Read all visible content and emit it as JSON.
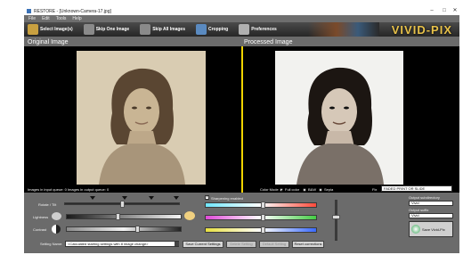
{
  "window": {
    "title": "RESTORE - [Unknown-Camera-17.jpg]",
    "minimize_glyph": "–",
    "maximize_glyph": "□",
    "close_glyph": "✕"
  },
  "menu": [
    "File",
    "Edit",
    "Tools",
    "Help"
  ],
  "toolbar": {
    "items": [
      {
        "label": "Select Image(s)",
        "icon": "folder-icon",
        "color": "#c8a040"
      },
      {
        "label": "Skip One Image",
        "icon": "skip-icon",
        "color": "#8a8a8a"
      },
      {
        "label": "Skip All Images",
        "icon": "skip-all-icon",
        "color": "#8a8a8a"
      },
      {
        "label": "Cropping",
        "icon": "crop-icon",
        "color": "#5a8ac0"
      },
      {
        "label": "Preferences",
        "icon": "tools-icon",
        "color": "#b0b0b0"
      }
    ],
    "brand": "VIVID-PIX"
  },
  "panels": {
    "original_label": "Original Image",
    "processed_label": "Processed Image"
  },
  "status": {
    "text": "Images in input queue: 0  Images in output queue: 0"
  },
  "controls": {
    "rotate_tilt_label": "Rotate / Tilt",
    "lightness_label": "Lightness",
    "contrast_label": "Contrast",
    "sharpening_label": "Sharpening enabled",
    "sharpening_enabled": true,
    "color_mode_label": "Color Mode",
    "color_mode_options": [
      "Full color",
      "B&W",
      "Sepia"
    ],
    "color_mode_selected": "Full color",
    "fix_label": "Fix",
    "fix_value": "FADED PRINT OR SLIDE",
    "output_subdirectory_label": "Output subdirectory",
    "output_subdirectory_value": "Vivid",
    "output_suffix_label": "Output suffix",
    "output_suffix_value": "Vivid",
    "save_button": "Save Vivid-Pix",
    "setting_name_label": "Setting Name:",
    "setting_name_value": "<Calculated starting settings with 8 image change>",
    "save_current_button": "Save Current Settings",
    "disabled_button_1": "Delete Setting",
    "disabled_button_2": "Default Setting",
    "reset_button": "Reset corrections",
    "levels": {
      "rotate": 0.5,
      "lightness": 0.45,
      "contrast": 0.62,
      "red_cyan": 0.52,
      "green_magenta": 0.52,
      "blue_yellow": 0.52,
      "vertical": 0.42
    }
  },
  "colors": {
    "accent_divider": "#f1d400",
    "brand": "#e8c24a"
  }
}
